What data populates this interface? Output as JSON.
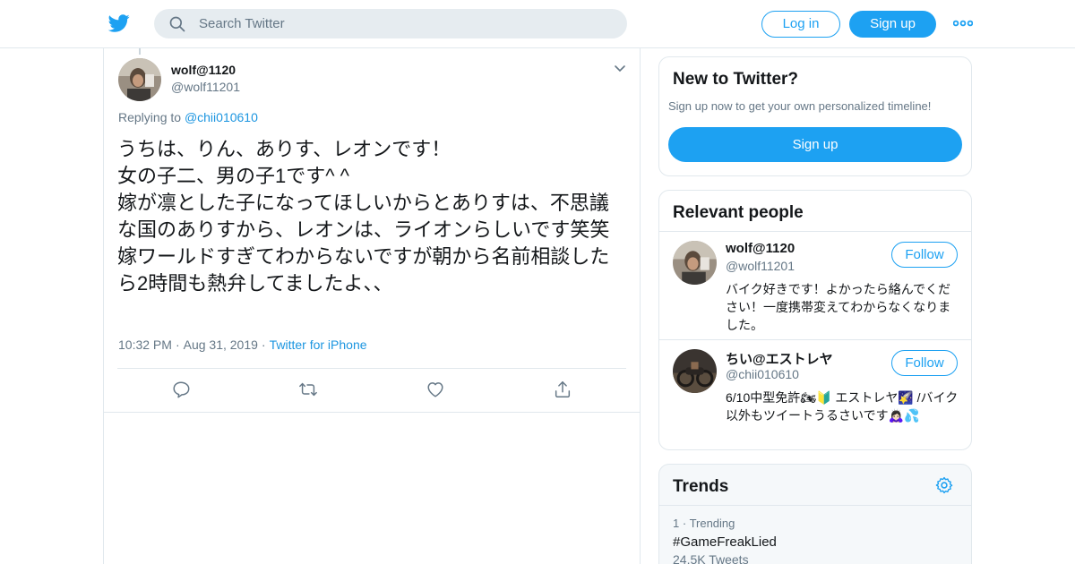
{
  "header": {
    "logo_icon": "twitter-bird-icon",
    "search_placeholder": "Search Twitter",
    "login_label": "Log in",
    "signup_label": "Sign up",
    "more_icon": "more-dots-icon",
    "brand_color": "#1da1f2"
  },
  "tweet": {
    "name": "wolf@1120",
    "handle": "@wolf11201",
    "replying_prefix": "Replying to ",
    "replying_to": "@chii010610",
    "text": "うちは、りん、ありす、レオンです！\n女の子二、男の子1です^ ^\n嫁が凛とした子になってほしいからとありすは、不思議な国のありすから、レオンは、ライオンらしいです笑笑\n嫁ワールドすぎてわからないですが朝から名前相談したら2時間も熱弁してましたよ、、",
    "time": "10:32 PM",
    "date": "Aug 31, 2019",
    "source": "Twitter for iPhone",
    "actions": [
      "reply-icon",
      "retweet-icon",
      "like-icon",
      "share-icon"
    ]
  },
  "sidebar": {
    "new_to_twitter": {
      "title": "New to Twitter?",
      "subtitle": "Sign up now to get your own personalized timeline!",
      "button": "Sign up"
    },
    "relevant_people": {
      "title": "Relevant people",
      "people": [
        {
          "name": "wolf@1120",
          "handle": "@wolf11201",
          "follow": "Follow",
          "bio": "バイク好きです！よかったら絡んでください！一度携帯変えてわからなくなりました。"
        },
        {
          "name": "ちい@エストレヤ",
          "handle": "@chii010610",
          "follow": "Follow",
          "bio": "6/10中型免許🏍🔰 エストレヤ🌠 /バイク以外もツイートうるさいです🙇🏻‍♀️💦"
        }
      ]
    },
    "trends": {
      "title": "Trends",
      "settings_icon": "gear-icon",
      "items": [
        {
          "rank": "1",
          "label": "Trending",
          "name": "#GameFreakLied",
          "count": "24.5K Tweets"
        }
      ]
    }
  }
}
